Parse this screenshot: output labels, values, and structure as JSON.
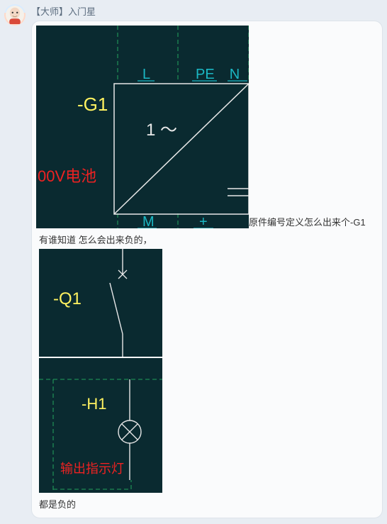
{
  "user": {
    "tag": "【大师】入门星"
  },
  "img1": {
    "labels": {
      "L": "L",
      "PE": "PE",
      "N": "N",
      "M": "M",
      "plus": "+"
    },
    "component": "-G1",
    "generator": "1 ～",
    "battery_text": "00V电池"
  },
  "text1": "原件编号定义怎么出来个-G1",
  "text2": "有谁知道 怎么会出来负的，",
  "img2": {
    "component": "-Q1"
  },
  "img3": {
    "component": "-H1",
    "annotation": "输出指示灯"
  },
  "text3": "都是负的"
}
